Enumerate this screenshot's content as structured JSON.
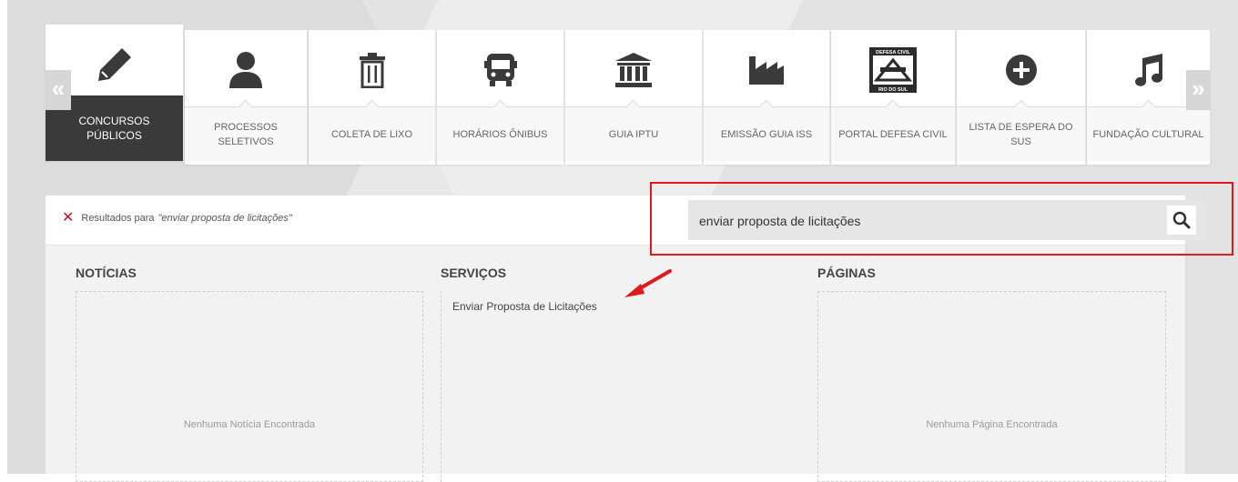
{
  "nav": {
    "items": [
      {
        "label": "CONCURSOS PÚBLICOS",
        "icon": "pencil-icon",
        "active": true
      },
      {
        "label": "PROCESSOS SELETIVOS",
        "icon": "person-icon"
      },
      {
        "label": "COLETA DE LIXO",
        "icon": "trash-icon"
      },
      {
        "label": "HORÁRIOS ÔNIBUS",
        "icon": "bus-icon"
      },
      {
        "label": "GUIA IPTU",
        "icon": "bank-icon"
      },
      {
        "label": "EMISSÃO GUIA ISS",
        "icon": "factory-icon"
      },
      {
        "label": "PORTAL DEFESA CIVIL",
        "icon": "defesa-civil-logo"
      },
      {
        "label": "LISTA DE ESPERA DO SUS",
        "icon": "plus-circle-icon"
      },
      {
        "label": "FUNDAÇÃO CULTURAL",
        "icon": "music-note-icon"
      }
    ],
    "prev_label": "«",
    "next_label": "»",
    "logo_text": {
      "top": "DEFESA CIVIL",
      "bottom": "RIO DO SUL"
    }
  },
  "results": {
    "prefix": "Resultados para",
    "query": "\"enviar proposta de licitações\""
  },
  "search": {
    "value": "enviar proposta de licitações"
  },
  "columns": {
    "noticias": {
      "title": "NOTÍCIAS",
      "empty": "Nenhuma Notícia Encontrada"
    },
    "servicos": {
      "title": "SERVIÇOS",
      "item": "Enviar Proposta de Licitações"
    },
    "paginas": {
      "title": "PÁGINAS",
      "empty": "Nenhuma Página Encontrada"
    }
  },
  "colors": {
    "accent": "#e0191d",
    "active_tile": "#3a3a3a"
  }
}
